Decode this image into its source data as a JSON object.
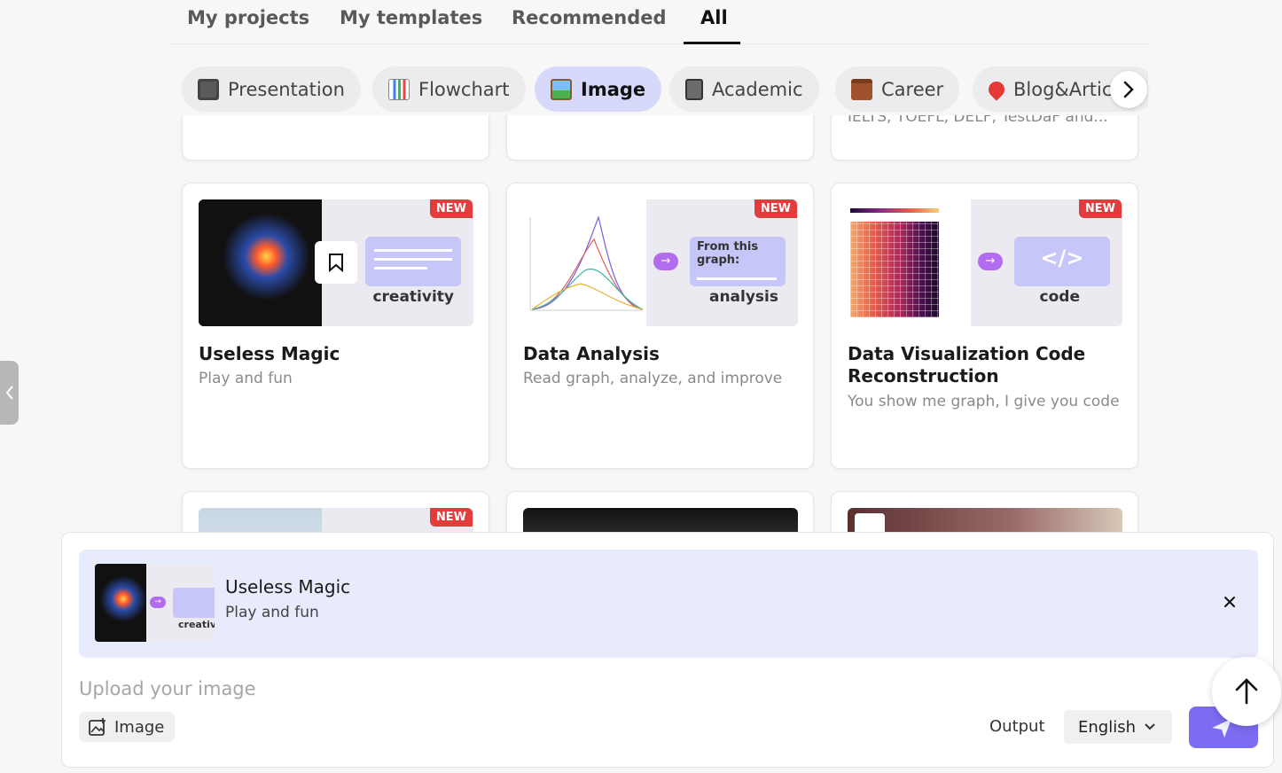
{
  "tabs": [
    {
      "label": "My projects"
    },
    {
      "label": "My templates"
    },
    {
      "label": "Recommended"
    },
    {
      "label": "All",
      "active": true
    }
  ],
  "chips": [
    {
      "label": "Presentation",
      "icon": "tv-icon"
    },
    {
      "label": "Flowchart",
      "icon": "bar-chart-icon"
    },
    {
      "label": "Image",
      "icon": "picture-icon",
      "active": true
    },
    {
      "label": "Academic",
      "icon": "notebook-icon"
    },
    {
      "label": "Career",
      "icon": "briefcase-icon"
    },
    {
      "label": "Blog&Artic",
      "icon": "pin-icon"
    }
  ],
  "top_partial_cards": {
    "third_card_text": "IELTS, TOEFL, DELF, TestDaF and..."
  },
  "cards": [
    {
      "title": "Useless Magic",
      "desc": "Play and fun",
      "badge": "NEW",
      "panel_label": "creativity"
    },
    {
      "title": "Data Analysis",
      "desc": "Read graph, analyze, and improve",
      "badge": "NEW",
      "panel_label": "analysis",
      "panel_text": "From this graph:"
    },
    {
      "title": "Data Visualization Code Reconstruction",
      "desc": "You show me graph, I give you code",
      "badge": "NEW",
      "panel_label": "code",
      "panel_text": "</>"
    }
  ],
  "bottom_partial_cards": [
    {
      "badge": "NEW"
    }
  ],
  "composer": {
    "selected_title": "Useless Magic",
    "selected_desc": "Play and fun",
    "selected_thumb_label": "creativi",
    "placeholder": "Upload your image",
    "image_button": "Image",
    "output_label": "Output",
    "language": "English"
  },
  "colors": {
    "accent": "#7b6cf1",
    "chip_active": "#d7d9fb",
    "badge": "#e23c3c"
  }
}
